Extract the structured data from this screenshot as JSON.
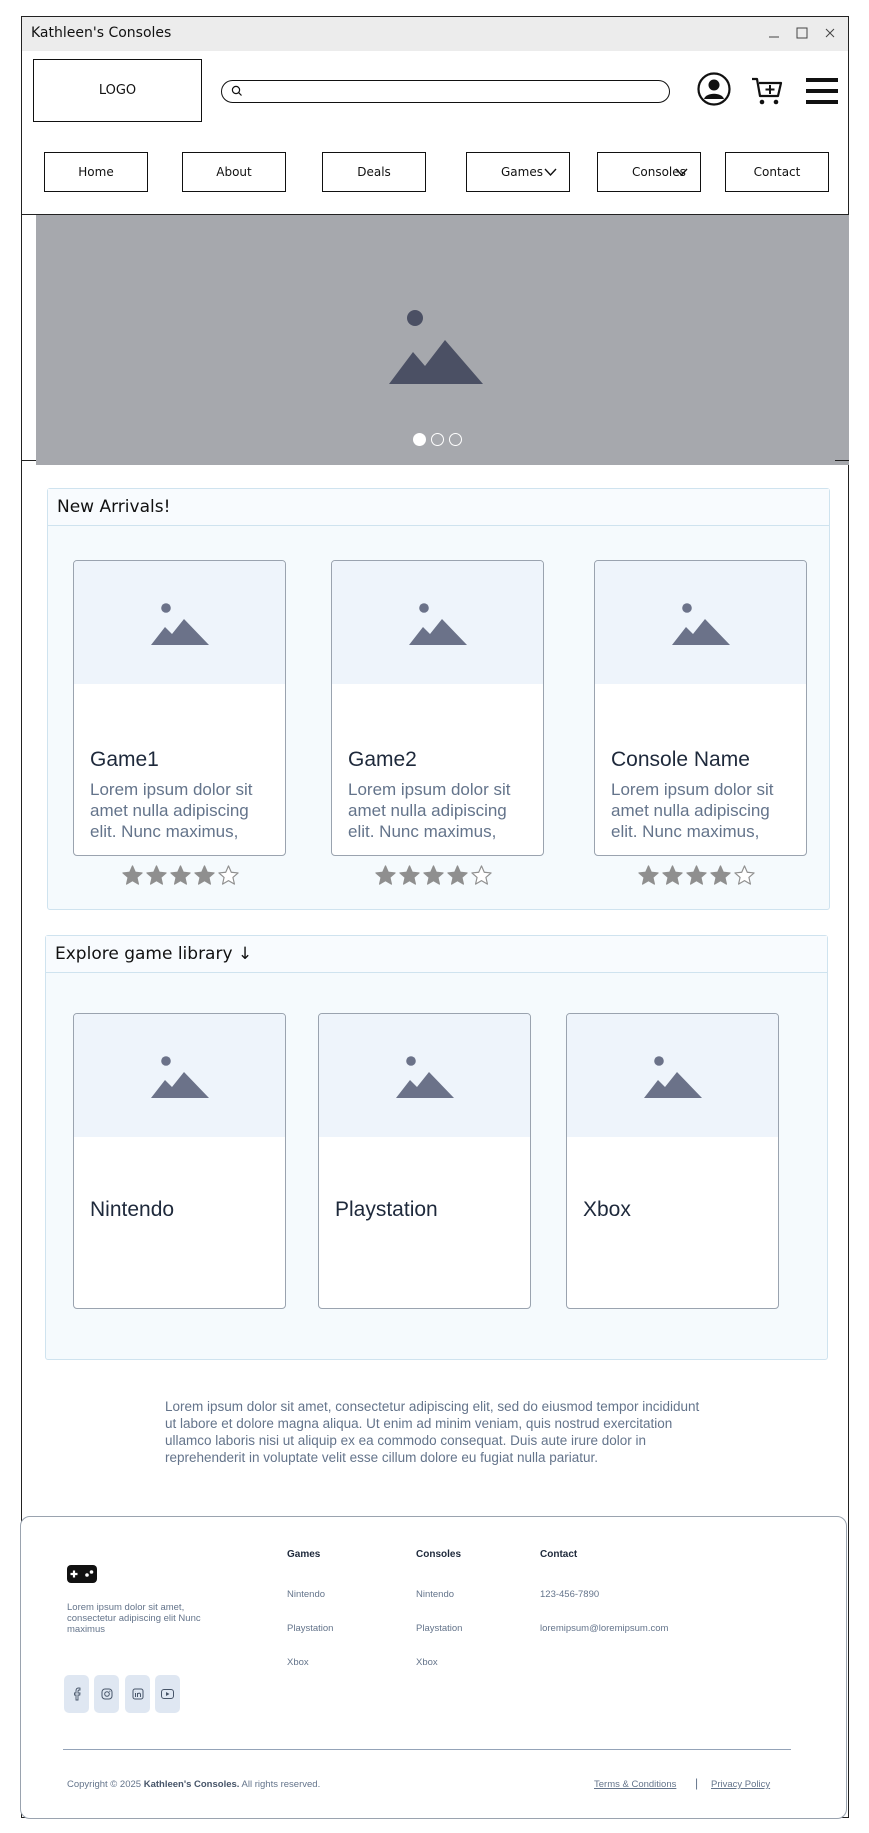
{
  "window": {
    "title": "Kathleen's Consoles"
  },
  "header": {
    "logo_label": "LOGO",
    "search_placeholder": "",
    "icons": [
      "user-icon",
      "cart-add-icon",
      "hamburger-menu-icon"
    ]
  },
  "nav": {
    "home": "Home",
    "about": "About",
    "deals": "Deals",
    "games": "Games",
    "consoles": "Consoles",
    "contact": "Contact"
  },
  "hero": {
    "slide_count": 3,
    "active_slide": 1
  },
  "new_arrivals": {
    "title": "New Arrivals!",
    "cards": [
      {
        "name": "Game1",
        "desc": "Lorem ipsum dolor sit amet nulla adipiscing elit. Nunc maximus,",
        "rating": 4,
        "max": 5
      },
      {
        "name": "Game2",
        "desc": "Lorem ipsum dolor sit amet nulla adipiscing elit. Nunc maximus,",
        "rating": 4,
        "max": 5
      },
      {
        "name": "Console Name",
        "desc": "Lorem ipsum dolor sit amet nulla adipiscing elit. Nunc maximus,",
        "rating": 4,
        "max": 5
      }
    ]
  },
  "library": {
    "title": "Explore game library ↓",
    "cards": [
      {
        "name": "Nintendo"
      },
      {
        "name": "Playstation"
      },
      {
        "name": "Xbox"
      }
    ]
  },
  "intro_text": "Lorem ipsum dolor sit amet, consectetur adipiscing elit, sed do eiusmod tempor incididunt ut labore et dolore magna aliqua. Ut enim ad minim veniam, quis nostrud exercitation ullamco laboris nisi ut aliquip ex ea commodo consequat. Duis aute irure dolor in reprehenderit in voluptate velit esse cillum dolore eu fugiat nulla pariatur.",
  "footer": {
    "desc": "Lorem ipsum dolor sit amet, consectetur adipiscing elit Nunc maximus",
    "social": [
      "facebook-icon",
      "instagram-icon",
      "linkedin-icon",
      "youtube-icon"
    ],
    "games": {
      "head": "Games",
      "links": [
        "Nintendo",
        "Playstation",
        "Xbox"
      ]
    },
    "consoles": {
      "head": "Consoles",
      "links": [
        "Nintendo",
        "Playstation",
        "Xbox"
      ]
    },
    "contact": {
      "head": "Contact",
      "phone": "123-456-7890",
      "email": "loremipsum@loremipsum.com"
    },
    "copyright_prefix": "Copyright © 2025",
    "copyright_brand": "Kathleen's Consoles.",
    "copyright_suffix": "All rights reserved.",
    "terms": "Terms & Conditions",
    "separator": "|",
    "privacy": "Privacy Policy"
  },
  "colors": {
    "accent": "#1e293b",
    "muted": "#64748b",
    "panel_bg": "#f5fafd",
    "hero_bg": "#a6a8ad"
  }
}
